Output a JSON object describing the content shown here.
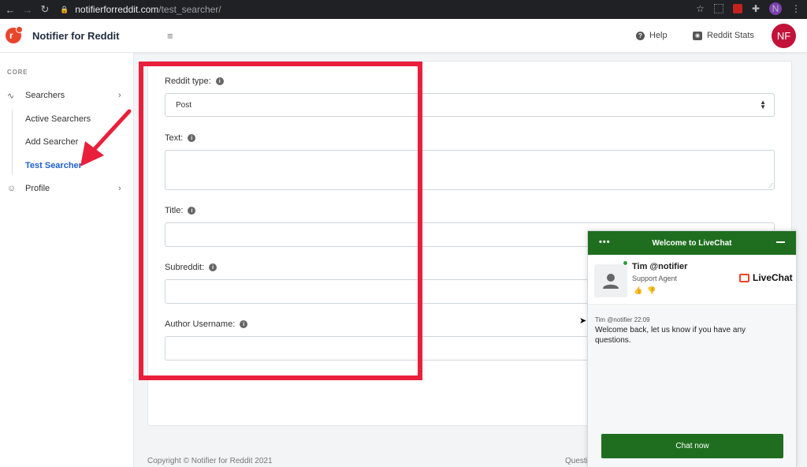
{
  "browser": {
    "url_host": "notifierforreddit.com",
    "url_path": "/test_searcher/",
    "profile_initial": "N"
  },
  "header": {
    "brand": "Notifier for Reddit",
    "help_label": "Help",
    "stats_label": "Reddit Stats",
    "avatar_initials": "NF"
  },
  "sidebar": {
    "section_heading": "CORE",
    "searchers_label": "Searchers",
    "sub_items": [
      "Active Searchers",
      "Add Searcher",
      "Test Searcher"
    ],
    "profile_label": "Profile"
  },
  "form": {
    "reddit_type_label": "Reddit type:",
    "reddit_type_value": "Post",
    "text_label": "Text:",
    "title_label": "Title:",
    "subreddit_label": "Subreddit:",
    "author_label": "Author Username:"
  },
  "footer": {
    "copyright": "Copyright © Notifier for Reddit 2021",
    "right_text": "Questi"
  },
  "livechat": {
    "header_title": "Welcome to LiveChat",
    "agent_name": "Tim @notifier",
    "agent_role": "Support Agent",
    "brand": "LiveChat",
    "message_meta": "Tim @notifier 22:09",
    "message_text": "Welcome back, let us know if you have any questions.",
    "chat_button": "Chat now"
  },
  "colors": {
    "highlight": "#ea1f3b",
    "livechat_green": "#1f6e1f",
    "active_link": "#1e5fcc",
    "avatar": "#c2123a"
  }
}
